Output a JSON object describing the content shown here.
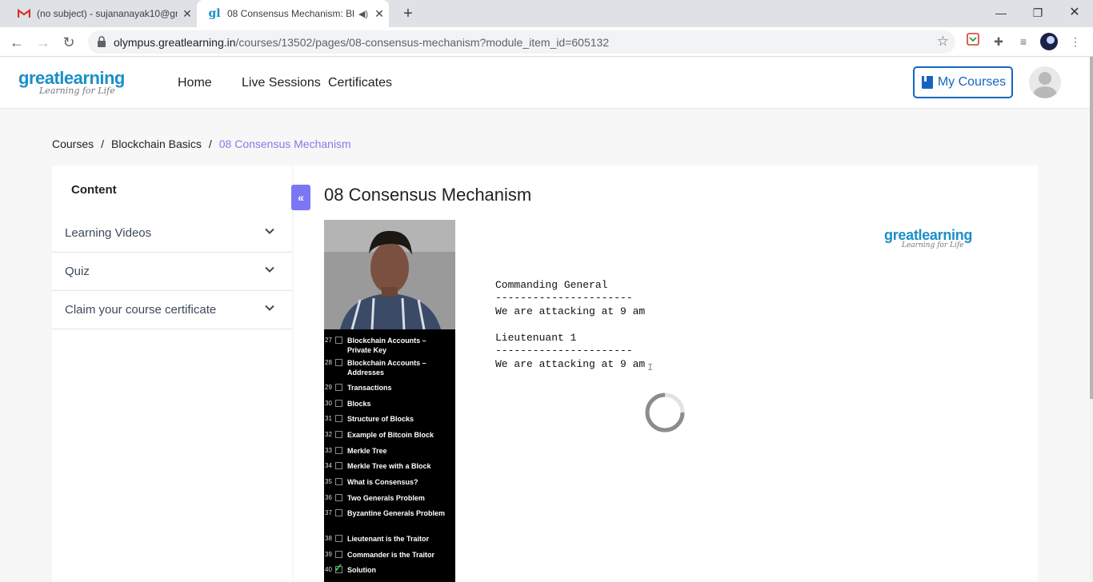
{
  "browser": {
    "tabs": [
      {
        "title": "(no subject) - sujananayak10@gm",
        "favicon": "gmail-icon"
      },
      {
        "title": "08 Consensus Mechanism: Bl",
        "favicon": "greatlearning-icon",
        "audio": true
      }
    ],
    "url_domain": "olympus.greatlearning.in",
    "url_path": "/courses/13502/pages/08-consensus-mechanism?module_item_id=605132"
  },
  "header": {
    "logo_main": "greatlearning",
    "logo_tagline": "Learning for Life",
    "nav": [
      "Home",
      "Live Sessions",
      "Certificates"
    ],
    "my_courses": "My Courses"
  },
  "breadcrumb": {
    "items": [
      "Courses",
      "Blockchain Basics",
      "08 Consensus Mechanism"
    ],
    "separator": "/"
  },
  "sidebar": {
    "heading": "Content",
    "items": [
      {
        "label": "Learning Videos"
      },
      {
        "label": "Quiz"
      },
      {
        "label": "Claim your course certificate"
      }
    ]
  },
  "main": {
    "title": "08 Consensus Mechanism",
    "collapse_label": "«"
  },
  "video": {
    "lessons": [
      {
        "num": "27",
        "title": "Blockchain Accounts – Private Key",
        "done": false
      },
      {
        "num": "28",
        "title": "Blockchain Accounts – Addresses",
        "done": false
      },
      {
        "num": "29",
        "title": "Transactions",
        "done": false
      },
      {
        "num": "30",
        "title": "Blocks",
        "done": false
      },
      {
        "num": "31",
        "title": "Structure of Blocks",
        "done": false
      },
      {
        "num": "32",
        "title": "Example of Bitcoin Block",
        "done": false
      },
      {
        "num": "33",
        "title": "Merkle Tree",
        "done": false
      },
      {
        "num": "34",
        "title": "Merkle Tree with a Block",
        "done": false
      },
      {
        "num": "35",
        "title": "What is Consensus?",
        "done": false
      },
      {
        "num": "36",
        "title": "Two Generals Problem",
        "done": false
      },
      {
        "num": "37",
        "title": "Byzantine Generals Problem",
        "done": false
      },
      {
        "num": "38",
        "title": "Lieutenant is the Traitor",
        "done": false
      },
      {
        "num": "39",
        "title": "Commander is the Traitor",
        "done": false
      },
      {
        "num": "40",
        "title": "Solution",
        "done": true
      }
    ],
    "logo_main": "greatlearning",
    "logo_tagline": "Learning for Life",
    "slide": {
      "block1_title": "Commanding General",
      "block1_rule": "----------------------",
      "block1_text": "We are attacking at 9 am",
      "block2_title": "Lieutenuant 1",
      "block2_rule": "----------------------",
      "block2_text": "We are attacking at 9 am"
    },
    "loading": true
  }
}
